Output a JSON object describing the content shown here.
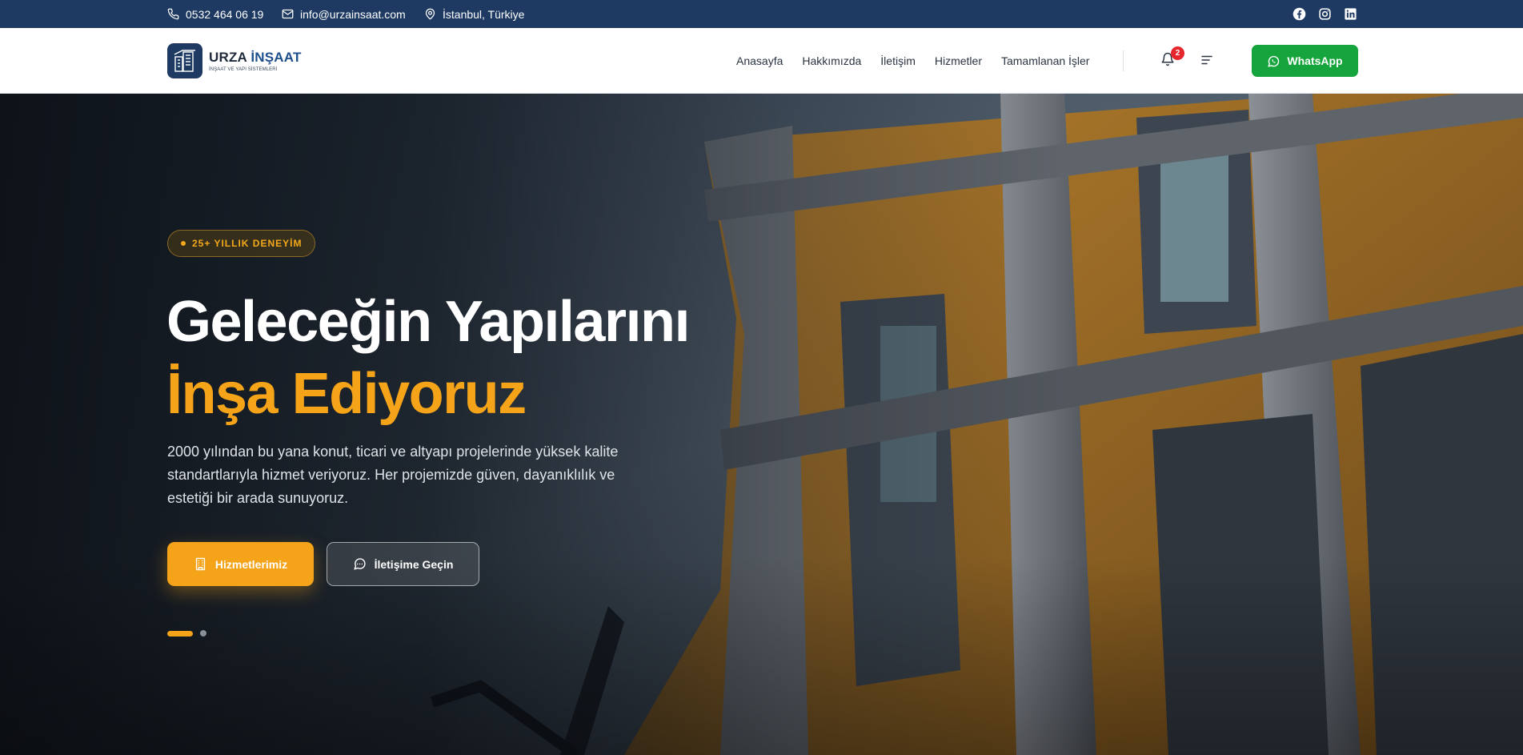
{
  "topbar": {
    "phone": "0532 464 06 19",
    "email": "info@urzainsaat.com",
    "location": "İstanbul, Türkiye",
    "social": [
      "facebook-icon",
      "instagram-icon",
      "linkedin-icon"
    ]
  },
  "header": {
    "logo": {
      "name_part1": "URZA ",
      "name_part2": "İNŞAAT",
      "tagline": "İNŞAAT VE YAPI SİSTEMLERİ"
    },
    "nav": [
      "Anasayfa",
      "Hakkımızda",
      "İletişim",
      "Hizmetler",
      "Tamamlanan İşler"
    ],
    "notification_count": "2",
    "whatsapp_label": "WhatsApp"
  },
  "hero": {
    "badge": "25+ YILLIK DENEYİM",
    "title_line1": "Geleceğin Yapılarını",
    "title_line2": "İnşa Ediyoruz",
    "description": "2000 yılından bu yana konut, ticari ve altyapı projelerinde yüksek kalite standartlarıyla hizmet veriyoruz. Her projemizde güven, dayanıklılık ve estetiği bir arada sunuyoruz.",
    "primary_button": "Hizmetlerimiz",
    "secondary_button": "İletişime Geçin",
    "slide_count": 2,
    "active_slide": 1
  },
  "colors": {
    "topbar": "#1e3a62",
    "accent": "#f5a318",
    "whatsapp": "#16a53c",
    "badge": "#e5262c"
  }
}
